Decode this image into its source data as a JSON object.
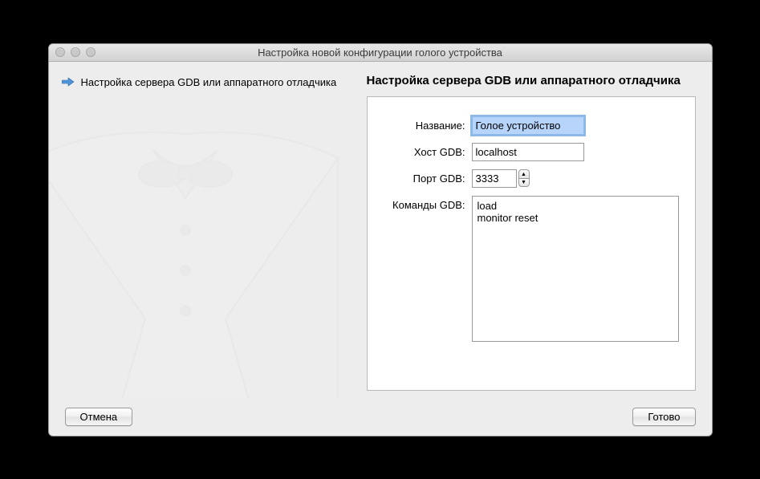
{
  "window": {
    "title": "Настройка новой конфигурации голого устройства"
  },
  "sidebar": {
    "current_step": "Настройка сервера GDB или аппаратного отладчика"
  },
  "form": {
    "heading": "Настройка сервера GDB или аппаратного отладчика",
    "name_label": "Название:",
    "name_value": "Голое устройство",
    "host_label": "Хост GDB:",
    "host_value": "localhost",
    "port_label": "Порт GDB:",
    "port_value": "3333",
    "commands_label": "Команды GDB:",
    "commands_value": "load\nmonitor reset"
  },
  "buttons": {
    "cancel": "Отмена",
    "done": "Готово"
  }
}
